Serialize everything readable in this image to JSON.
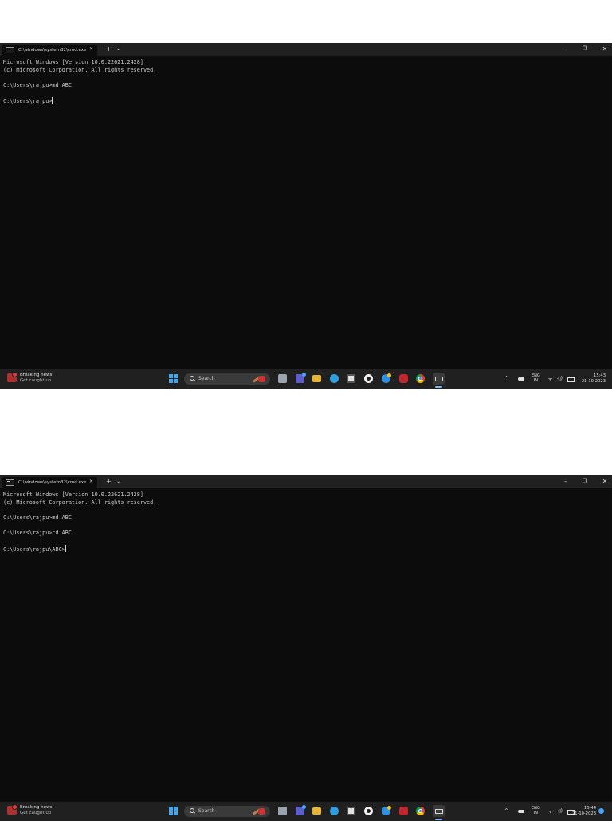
{
  "screenshots": [
    {
      "tab_title": "C:\\windows\\system32\\cmd.exe",
      "lines": [
        "Microsoft Windows [Version 10.0.22621.2428]",
        "(c) Microsoft Corporation. All rights reserved.",
        "",
        "C:\\Users\\rajpu>md ABC",
        "",
        "C:\\Users\\rajpu>"
      ],
      "taskbar": {
        "news_title": "Breaking news",
        "news_subtitle": "Get caught up",
        "news_badge": "1",
        "search_label": "Search",
        "lang_line1": "ENG",
        "lang_line2": "IN",
        "time": "15:43",
        "date": "21-10-2023"
      }
    },
    {
      "tab_title": "C:\\windows\\system32\\cmd.exe",
      "lines": [
        "Microsoft Windows [Version 10.0.22621.2428]",
        "(c) Microsoft Corporation. All rights reserved.",
        "",
        "C:\\Users\\rajpu>md ABC",
        "",
        "C:\\Users\\rajpu>cd ABC",
        "",
        "C:\\Users\\rajpu\\ABC>"
      ],
      "taskbar": {
        "news_title": "Breaking news",
        "news_subtitle": "Get caught up",
        "news_badge": "1",
        "search_label": "Search",
        "lang_line1": "ENG",
        "lang_line2": "IN",
        "time": "15:44",
        "date": "21-10-2023"
      }
    }
  ],
  "titlebar": {
    "new_tab_glyph": "+",
    "dropdown_glyph": "⌄",
    "minimize_glyph": "–",
    "maximize_glyph": "❐",
    "close_glyph": "✕",
    "tab_close_glyph": "✕"
  },
  "tray_glyphs": {
    "chevron": "^",
    "wifi": "ᯤ",
    "volume": "◁)"
  },
  "colors": {
    "console_bg": "#0c0c0c",
    "console_text": "#cccccc",
    "titlebar_bg": "#202020",
    "taskbar_bg": "#202020",
    "accent": "#3fa9f5"
  }
}
